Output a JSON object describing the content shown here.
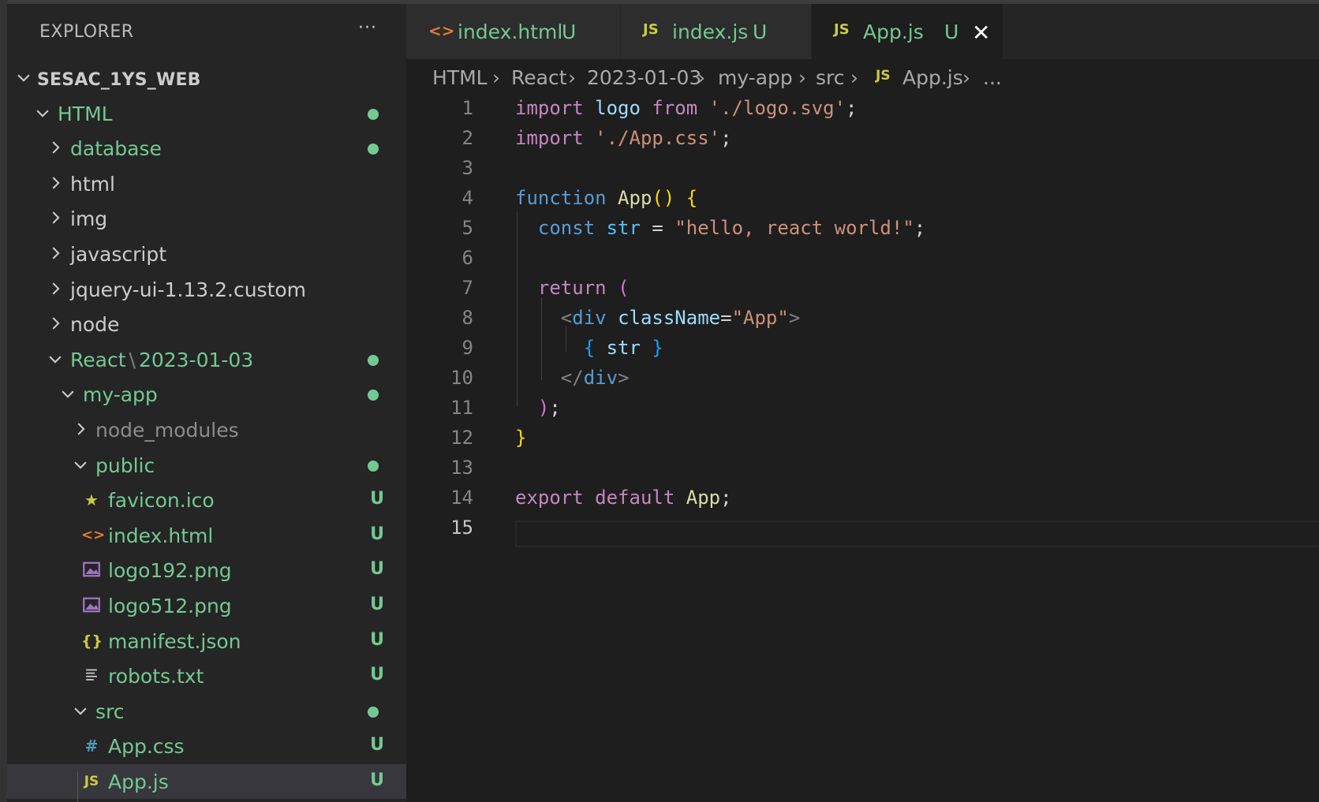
{
  "explorer": {
    "title": "EXPLORER",
    "more": "···",
    "root": "SESAC_1YS_WEB",
    "items": [
      {
        "label": "HTML"
      },
      {
        "label": "database"
      },
      {
        "label": "html"
      },
      {
        "label": "img"
      },
      {
        "label": "javascript"
      },
      {
        "label": "jquery-ui-1.13.2.custom"
      },
      {
        "label": "node"
      },
      {
        "label": "React",
        "label2": "2023-01-03",
        "sep": "\\"
      },
      {
        "label": "my-app"
      },
      {
        "label": "node_modules"
      },
      {
        "label": "public"
      },
      {
        "label": "favicon.ico",
        "status": "U"
      },
      {
        "label": "index.html",
        "status": "U"
      },
      {
        "label": "logo192.png",
        "status": "U"
      },
      {
        "label": "logo512.png",
        "status": "U"
      },
      {
        "label": "manifest.json",
        "status": "U"
      },
      {
        "label": "robots.txt",
        "status": "U"
      },
      {
        "label": "src"
      },
      {
        "label": "App.css",
        "status": "U"
      },
      {
        "label": "App.js",
        "status": "U"
      }
    ]
  },
  "tabs": [
    {
      "icon": "<>",
      "label": "index.html",
      "status": "U"
    },
    {
      "icon": "JS",
      "label": "index.js",
      "status": "U"
    },
    {
      "icon": "JS",
      "label": "App.js",
      "status": "U",
      "close": "✕"
    }
  ],
  "breadcrumb": {
    "items": [
      "HTML",
      "React",
      "2023-01-03",
      "my-app",
      "src",
      "App.js",
      "..."
    ],
    "js_icon": "JS",
    "sep": "›"
  },
  "editor": {
    "line_numbers": [
      "1",
      "2",
      "3",
      "4",
      "5",
      "6",
      "7",
      "8",
      "9",
      "10",
      "11",
      "12",
      "13",
      "14",
      "15"
    ],
    "code": {
      "l1": {
        "kw": "import",
        "var": "logo",
        "from": "from",
        "str": "'./logo.svg'",
        "end": ";"
      },
      "l2": {
        "kw": "import",
        "str": "'./App.css'",
        "end": ";"
      },
      "l4": {
        "kw": "function",
        "fn": "App",
        "paren": "()",
        "brace": "{"
      },
      "l5": {
        "kw": "const",
        "var": "str",
        "op": "=",
        "str": "\"hello, react world!\"",
        "end": ";"
      },
      "l7": {
        "kw": "return",
        "paren": "("
      },
      "l8": {
        "lt": "<",
        "tag": "div",
        "attr": "className",
        "eq": "=",
        "str": "\"App\"",
        "gt": ">"
      },
      "l9": {
        "ob": "{",
        "var": "str",
        "cb": "}"
      },
      "l10": {
        "lt": "</",
        "tag": "div",
        "gt": ">"
      },
      "l11": {
        "paren": ")",
        "end": ";"
      },
      "l12": {
        "brace": "}"
      },
      "l14": {
        "kw1": "export",
        "kw2": "default",
        "name": "App",
        "end": ";"
      }
    }
  },
  "colors": {
    "git_untracked": "#73c991",
    "js_icon": "#cbcb41",
    "html_icon": "#e37933",
    "css_icon": "#519aba",
    "png_icon": "#a074c4",
    "json_icon": "#cbcb41",
    "favicon_icon": "#cbcb41"
  },
  "icons": {
    "chevron_right": "chevron-right-icon",
    "chevron_down": "chevron-down-icon",
    "favicon": "star-icon",
    "html": "html-icon",
    "png": "image-icon",
    "json": "json-icon",
    "txt": "text-lines-icon",
    "css": "hash-icon",
    "js": "js-icon"
  }
}
